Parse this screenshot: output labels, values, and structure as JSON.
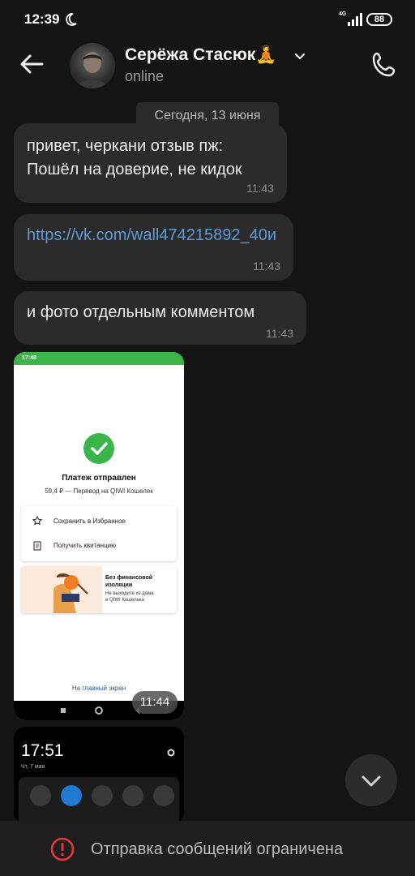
{
  "status_bar": {
    "time": "12:39",
    "network": "4G",
    "battery": "88"
  },
  "header": {
    "name": "Серёжа Стасюк🧘",
    "status": "online"
  },
  "chat": {
    "date_divider": "Сегодня, 13 июня",
    "messages": [
      {
        "text": "привет, черкани отзыв пж:\nПошёл на доверие, не кидок",
        "time": "11:43"
      },
      {
        "text": "https://vk.com/wall474215892_40и",
        "time": "11:43",
        "is_link": true
      },
      {
        "text": "и фото отдельным комментом",
        "time": "11:43"
      }
    ],
    "image_message": {
      "time": "11:44",
      "inner": {
        "status_time": "17:48",
        "title": "Платеж отправлен",
        "subtitle": "59,4 ₽ — Перевод на QIWI Кошелек",
        "actions": [
          "Сохранить в Избранное",
          "Получить квитанцию"
        ],
        "promo_title": "Без финансовой\nизоляции",
        "promo_text": "Не выходите из дома\nи QIWI Кошелька",
        "home_link": "На главный экран"
      }
    },
    "image_message_2": {
      "time": "17:51",
      "date": "Чт, 7 мая"
    }
  },
  "footer": {
    "restriction_text": "Отправка сообщений ограничена"
  },
  "colors": {
    "accent_link": "#5e9bd6",
    "success": "#3bb54a",
    "warning": "#e0383e"
  }
}
